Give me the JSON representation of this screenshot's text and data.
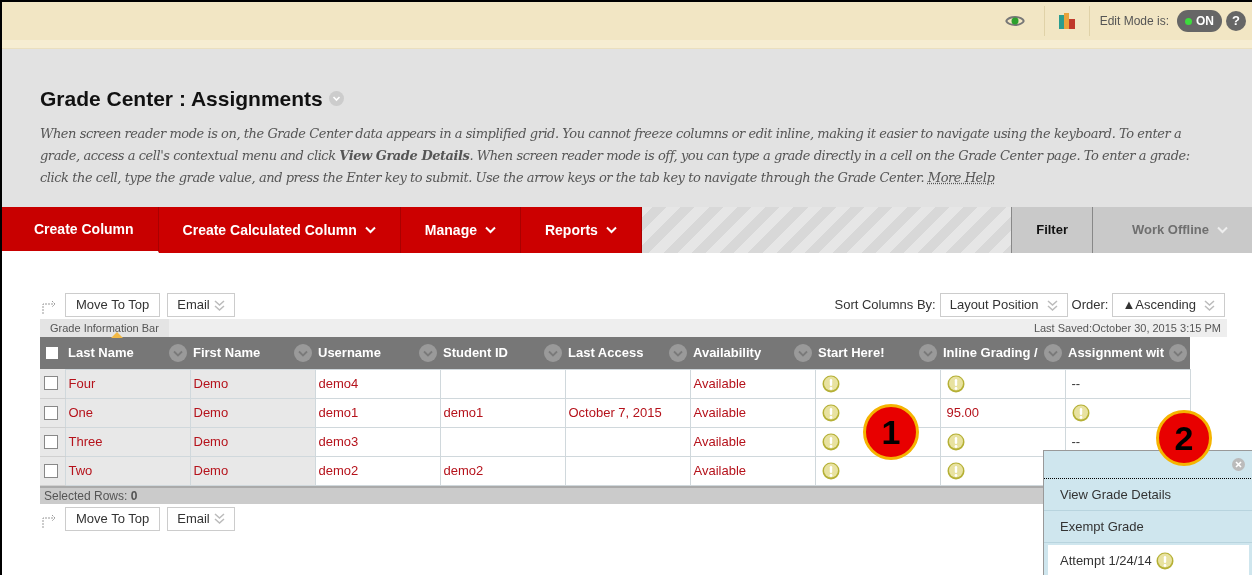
{
  "top_bar": {
    "edit_mode_label": "Edit Mode is:",
    "edit_mode": {
      "label": "ON",
      "on": true
    },
    "help": "?"
  },
  "header": {
    "title": "Grade Center : Assignments",
    "description": "When screen reader mode is on, the Grade Center data appears in a simplified grid. You cannot freeze columns or edit inline, making it easier to navigate using the keyboard. To enter a grade, access a cell's contextual menu and click **View Grade Details**. When screen reader mode is off, you can type a grade directly in a cell on the Grade Center page. To enter a grade: click the cell, type the grade value, and press the Enter key to submit. Use the arrow keys or the tab key to navigate through the Grade Center.",
    "help_link": "More Help"
  },
  "action_bar": {
    "items": [
      {
        "label": "Create Column",
        "dropdown": false,
        "selected": true
      },
      {
        "label": "Create Calculated Column",
        "dropdown": true,
        "selected": false
      },
      {
        "label": "Manage",
        "dropdown": true,
        "selected": false
      },
      {
        "label": "Reports",
        "dropdown": true,
        "selected": false
      }
    ],
    "right_items": [
      {
        "label": "Filter",
        "dropdown": false,
        "disabled": false
      },
      {
        "label": "Work Offline",
        "dropdown": true,
        "disabled": true
      }
    ]
  },
  "top_buttons": {
    "move": "Move To Top",
    "email": "Email"
  },
  "sort": {
    "label": "Sort Columns By:",
    "value": "Layout Position",
    "order_label": "Order:",
    "order_value": "▲Ascending"
  },
  "info_bar": {
    "label": "Grade Information Bar",
    "last_saved": "Last Saved:October 30, 2015 3:15 PM"
  },
  "table": {
    "all_checked": false,
    "columns": [
      "Last Name",
      "First Name",
      "Username",
      "Student ID",
      "Last Access",
      "Availability",
      "Start Here!",
      "Inline Grading /",
      "Assignment wit"
    ],
    "rows": [
      {
        "checked": false,
        "cells": [
          "Four",
          "Demo",
          "demo4",
          "",
          "",
          "Available"
        ],
        "grades": [
          {
            "kind": "needs_grading"
          },
          {
            "kind": "needs_grading"
          },
          {
            "kind": "text",
            "text": "--"
          }
        ]
      },
      {
        "checked": false,
        "cells": [
          "One",
          "Demo",
          "demo1",
          "demo1",
          "October 7, 2015",
          "Available"
        ],
        "grades": [
          {
            "kind": "needs_grading"
          },
          {
            "kind": "text",
            "text": "95.00"
          },
          {
            "kind": "needs_grading"
          }
        ]
      },
      {
        "checked": false,
        "cells": [
          "Three",
          "Demo",
          "demo3",
          "",
          "",
          "Available"
        ],
        "grades": [
          {
            "kind": "needs_grading"
          },
          {
            "kind": "needs_grading"
          },
          {
            "kind": "text",
            "text": "--"
          }
        ]
      },
      {
        "checked": false,
        "cells": [
          "Two",
          "Demo",
          "demo2",
          "demo2",
          "",
          "Available"
        ],
        "grades": [
          {
            "kind": "needs_grading"
          },
          {
            "kind": "needs_grading"
          },
          {
            "kind": "none"
          }
        ]
      }
    ],
    "selected_label": "Selected Rows:",
    "selected_count": "0"
  },
  "bottom_buttons": {
    "move": "Move To Top",
    "email": "Email"
  },
  "callouts": [
    "1",
    "2"
  ],
  "context_menu": {
    "items": [
      {
        "label": "View Grade Details",
        "kind": "link",
        "selected": false
      },
      {
        "label": "Exempt Grade",
        "kind": "link",
        "selected": false
      },
      {
        "label": "Attempt 1/24/14",
        "kind": "attempt",
        "selected": true
      }
    ]
  }
}
